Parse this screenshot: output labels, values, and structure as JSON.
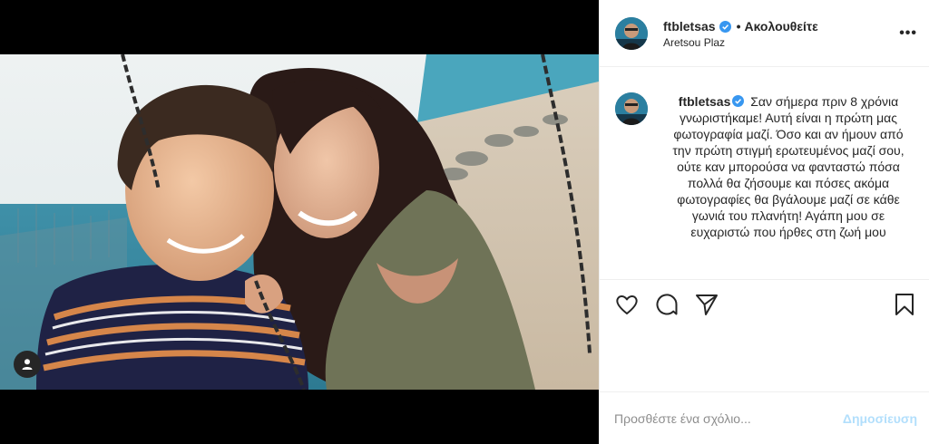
{
  "post": {
    "username": "ftbletsas",
    "follow_separator": "•",
    "follow_state": "Ακολουθείτε",
    "location": "Aretsou Plaz",
    "more_label": "•••"
  },
  "caption": {
    "username": "ftbletsas",
    "text": "Σαν σήμερα πριν 8 χρόνια γνωριστήκαμε! Αυτή είναι η πρώτη μας φωτογραφία μαζί. Όσο και αν ήμουν από την πρώτη στιγμή ερωτευμένος μαζί σου, ούτε καν μπορούσα να φανταστώ πόσα πολλά θα ζήσουμε και πόσες ακόμα φωτογραφίες θα βγάλουμε μαζί σε κάθε γωνιά του πλανήτη! Αγάπη μου σε ευχαριστώ που ήρθες στη ζωή μου"
  },
  "comment": {
    "placeholder": "Προσθέστε ένα σχόλιο...",
    "post_label": "Δημοσίευση"
  },
  "icons": {
    "like": "heart-icon",
    "comment": "comment-icon",
    "share": "share-icon",
    "save": "bookmark-icon",
    "user_tag": "user-icon",
    "verified": "verified-badge-icon"
  },
  "colors": {
    "verified_blue": "#3897f0",
    "post_button": "#b2dffc",
    "text": "#262626",
    "muted": "#8e8e8e"
  }
}
